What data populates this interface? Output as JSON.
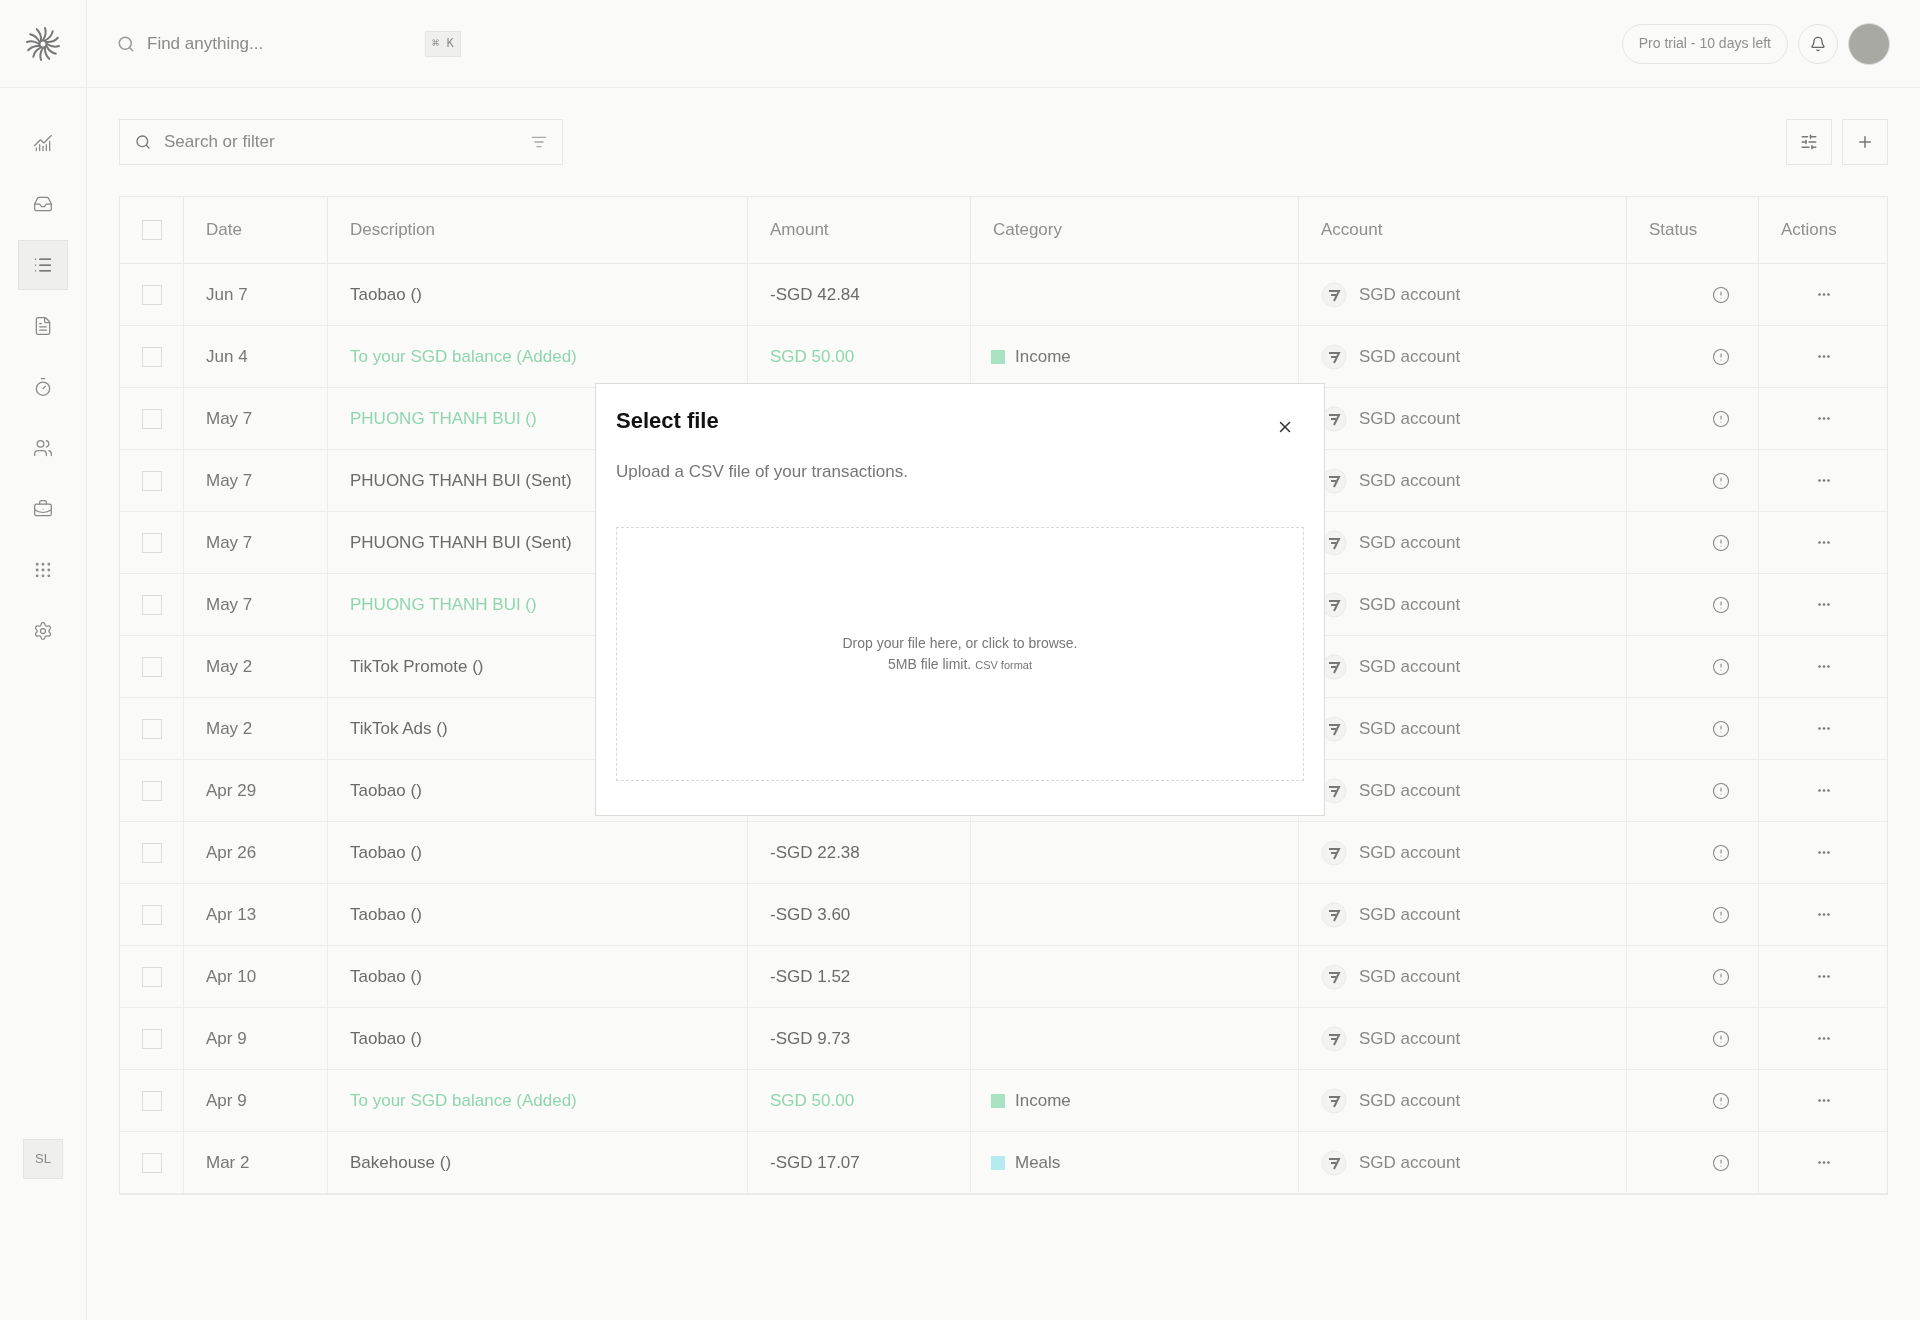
{
  "header": {
    "search": {
      "placeholder": "Find anything..."
    },
    "shortcut": "⌘ K",
    "trial_badge": "Pro trial - 10 days left"
  },
  "sidebar": {
    "items": [
      {
        "selected": false
      },
      {
        "selected": false
      },
      {
        "selected": true
      },
      {
        "selected": false
      },
      {
        "selected": false
      },
      {
        "selected": false
      },
      {
        "selected": false
      },
      {
        "selected": false
      },
      {
        "selected": false
      }
    ],
    "user_initials": "SL"
  },
  "toolbar": {
    "search": {
      "placeholder": "Search or filter"
    }
  },
  "table": {
    "columns": [
      "Date",
      "Description",
      "Amount",
      "Category",
      "Account",
      "Status",
      "Actions"
    ],
    "header_checked": false,
    "rows": [
      {
        "checked": false,
        "date": "Jun 7",
        "description": "Taobao ()",
        "kind": "debit",
        "amount": "-SGD 42.84",
        "account": "SGD account"
      },
      {
        "checked": false,
        "date": "Jun 4",
        "description": "To your SGD balance (Added)",
        "kind": "credit",
        "amount": "SGD 50.00",
        "category": {
          "name": "Income",
          "color": "#a8e2c1"
        },
        "account": "SGD account"
      },
      {
        "checked": false,
        "date": "May 7",
        "description": "PHUONG THANH BUI ()",
        "kind": "credit",
        "account": "SGD account"
      },
      {
        "checked": false,
        "date": "May 7",
        "description": "PHUONG THANH BUI (Sent)",
        "kind": "debit",
        "account": "SGD account"
      },
      {
        "checked": false,
        "date": "May 7",
        "description": "PHUONG THANH BUI (Sent)",
        "kind": "debit",
        "account": "SGD account"
      },
      {
        "checked": false,
        "date": "May 7",
        "description": "PHUONG THANH BUI ()",
        "kind": "credit",
        "account": "SGD account"
      },
      {
        "checked": false,
        "date": "May 2",
        "description": "TikTok Promote ()",
        "kind": "debit",
        "account": "SGD account"
      },
      {
        "checked": false,
        "date": "May 2",
        "description": "TikTok Ads ()",
        "kind": "debit",
        "account": "SGD account"
      },
      {
        "checked": false,
        "date": "Apr 29",
        "description": "Taobao ()",
        "kind": "debit",
        "account": "SGD account"
      },
      {
        "checked": false,
        "date": "Apr 26",
        "description": "Taobao ()",
        "kind": "debit",
        "amount": "-SGD 22.38",
        "account": "SGD account"
      },
      {
        "checked": false,
        "date": "Apr 13",
        "description": "Taobao ()",
        "kind": "debit",
        "amount": "-SGD 3.60",
        "account": "SGD account"
      },
      {
        "checked": false,
        "date": "Apr 10",
        "description": "Taobao ()",
        "kind": "debit",
        "amount": "-SGD 1.52",
        "account": "SGD account"
      },
      {
        "checked": false,
        "date": "Apr 9",
        "description": "Taobao ()",
        "kind": "debit",
        "amount": "-SGD 9.73",
        "account": "SGD account"
      },
      {
        "checked": false,
        "date": "Apr 9",
        "description": "To your SGD balance (Added)",
        "kind": "credit",
        "amount": "SGD 50.00",
        "category": {
          "name": "Income",
          "color": "#a8e2c1"
        },
        "account": "SGD account"
      },
      {
        "checked": false,
        "date": "Mar 2",
        "description": "Bakehouse ()",
        "kind": "debit",
        "amount": "-SGD 17.07",
        "category": {
          "name": "Meals",
          "color": "#b3ebef"
        },
        "account": "SGD account"
      }
    ]
  },
  "dialog": {
    "title": "Select file",
    "description": "Upload a CSV file of your transactions.",
    "dropzone": {
      "prompt": "Drop your file here, or click to browse.",
      "limit": "5MB file limit.",
      "format": "CSV format"
    }
  }
}
